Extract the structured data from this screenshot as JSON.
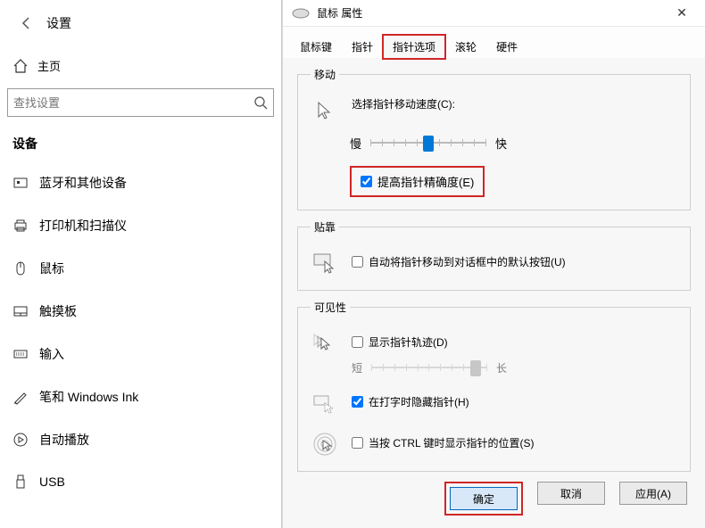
{
  "settings": {
    "title": "设置",
    "home": "主页",
    "search_placeholder": "查找设置",
    "section": "设备",
    "nav": [
      {
        "label": "蓝牙和其他设备"
      },
      {
        "label": "打印机和扫描仪"
      },
      {
        "label": "鼠标"
      },
      {
        "label": "触摸板"
      },
      {
        "label": "输入"
      },
      {
        "label": "笔和 Windows Ink"
      },
      {
        "label": "自动播放"
      },
      {
        "label": "USB"
      }
    ]
  },
  "dialog": {
    "title": "鼠标 属性",
    "tabs": [
      "鼠标键",
      "指针",
      "指针选项",
      "滚轮",
      "硬件"
    ],
    "active_tab": 2,
    "groups": {
      "motion": {
        "legend": "移动",
        "speed_label": "选择指针移动速度(C):",
        "slow": "慢",
        "fast": "快",
        "precision": "提高指针精确度(E)",
        "precision_checked": true,
        "speed_value": 50
      },
      "snap": {
        "legend": "贴靠",
        "label": "自动将指针移动到对话框中的默认按钮(U)",
        "checked": false
      },
      "visibility": {
        "legend": "可见性",
        "trails_label": "显示指针轨迹(D)",
        "trails_checked": false,
        "short": "短",
        "long": "长",
        "trails_value": 90,
        "hide_typing_label": "在打字时隐藏指针(H)",
        "hide_typing_checked": true,
        "ctrl_label": "当按 CTRL 键时显示指针的位置(S)",
        "ctrl_checked": false
      }
    },
    "buttons": {
      "ok": "确定",
      "cancel": "取消",
      "apply": "应用(A)"
    }
  }
}
